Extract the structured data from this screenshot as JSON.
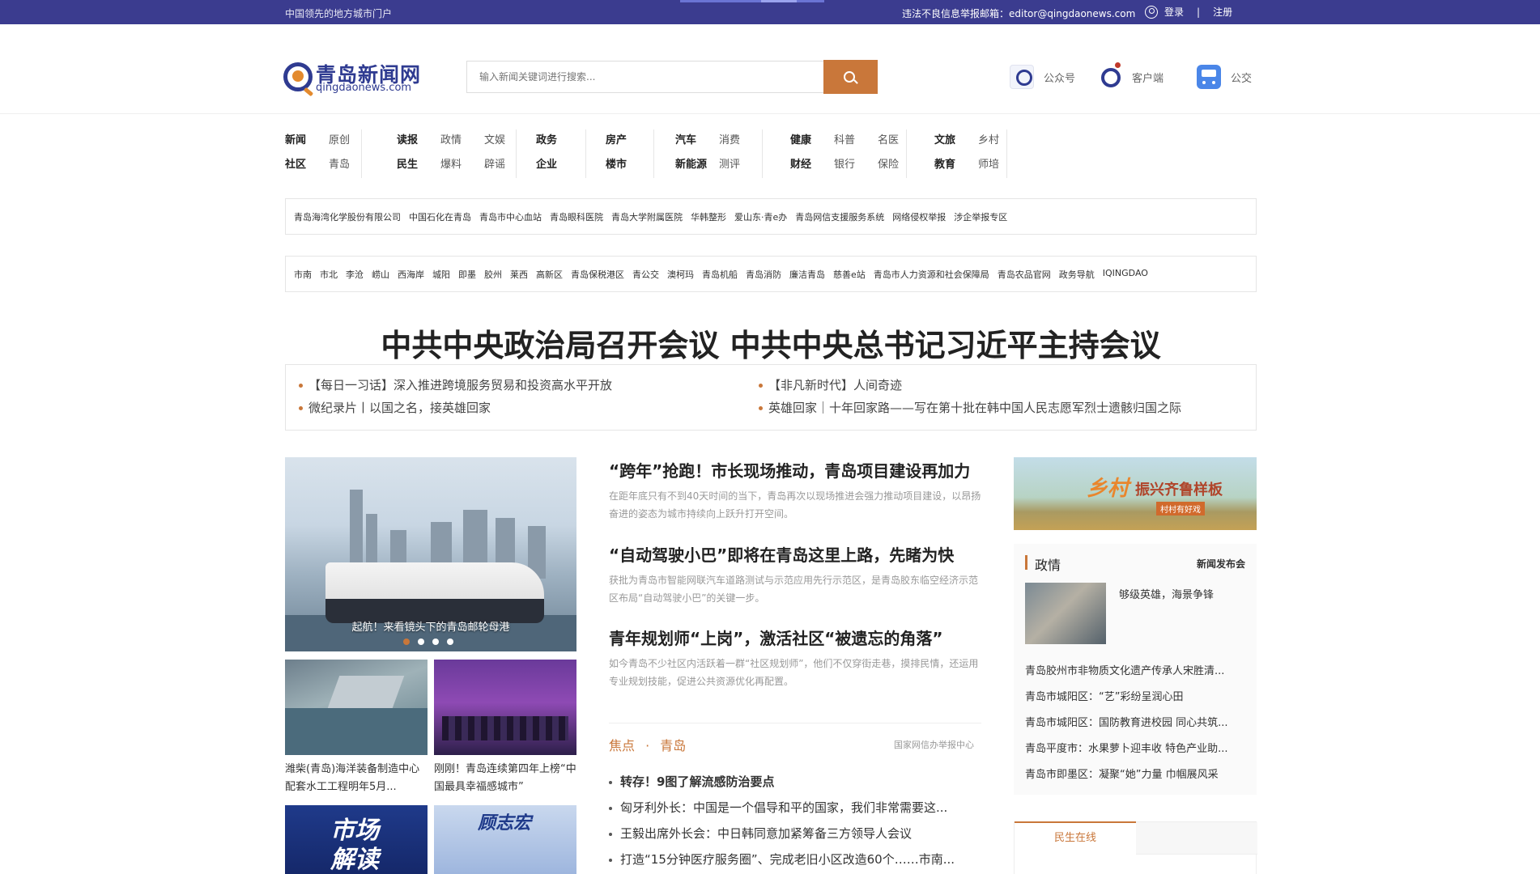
{
  "topbar": {
    "tagline": "中国领先的地方城市门户",
    "report": "违法不良信息举报邮箱：editor@qingdaonews.com",
    "login": "登录",
    "separator": "|",
    "register": "注册"
  },
  "header": {
    "logo_name": "青岛新闻网",
    "logo_domain": "qingdaonews.com",
    "search_placeholder": "输入新闻关键词进行搜索...",
    "links": [
      {
        "label": "公众号",
        "icon": "wechat-account-icon"
      },
      {
        "label": "客户端",
        "icon": "app-client-icon"
      },
      {
        "label": "公交",
        "icon": "bus-icon"
      }
    ]
  },
  "nav": {
    "groups": [
      {
        "rows": [
          [
            "新闻",
            "原创"
          ],
          [
            "社区",
            "青岛"
          ]
        ]
      },
      {
        "rows": [
          [
            "读报",
            "政情",
            "文娱"
          ],
          [
            "民生",
            "爆料",
            "辟谣"
          ]
        ]
      },
      {
        "rows": [
          [
            "政务"
          ],
          [
            "企业"
          ]
        ]
      },
      {
        "rows": [
          [
            "房产"
          ],
          [
            "楼市"
          ]
        ]
      },
      {
        "rows": [
          [
            "汽车",
            "消费"
          ],
          [
            "新能源",
            "测评"
          ]
        ]
      },
      {
        "rows": [
          [
            "健康",
            "科普",
            "名医"
          ],
          [
            "财经",
            "银行",
            "保险"
          ]
        ]
      },
      {
        "rows": [
          [
            "文旅",
            "乡村"
          ],
          [
            "教育",
            "师培"
          ]
        ]
      }
    ]
  },
  "link_rows": {
    "row1": [
      "青岛海湾化学股份有限公司",
      "中国石化在青岛",
      "青岛市中心血站",
      "青岛眼科医院",
      "青岛大学附属医院",
      "华韩整形",
      "爱山东·青e办",
      "青岛网信支援服务系统",
      "网络侵权举报",
      "涉企举报专区"
    ],
    "row2": [
      "市南",
      "市北",
      "李沧",
      "崂山",
      "西海岸",
      "城阳",
      "即墨",
      "胶州",
      "莱西",
      "高新区",
      "青岛保税港区",
      "青公交",
      "澳柯玛",
      "青岛机船",
      "青岛消防",
      "廉洁青岛",
      "慈善e站",
      "青岛市人力资源和社会保障局",
      "青岛农品官网",
      "政务导航",
      "IQINGDAO"
    ]
  },
  "headline": {
    "title": "中共中央政治局召开会议 中共中央总书记习近平主持会议",
    "subs": [
      "【每日一习话】深入推进跨境服务贸易和投资高水平开放",
      "【非凡新时代】人间奇迹",
      "微纪录片丨以国之名，接英雄回家",
      "英雄回家｜十年回家路——写在第十批在韩中国人民志愿军烈士遗骸归国之际"
    ]
  },
  "slider": {
    "caption": "起航！来看镜头下的青岛邮轮母港",
    "dots": 4,
    "active": 1
  },
  "thumbs": [
    {
      "caption": "潍柴(青岛)海洋装备制造中心配套水工工程明年5月..."
    },
    {
      "caption": "刚刚！青岛连续第四年上榜“中国最具幸福感城市”"
    },
    {
      "caption": "",
      "overlay": "市场解读"
    },
    {
      "caption": "",
      "overlay": "顾志宏"
    }
  ],
  "news": [
    {
      "title": "“跨年”抢跑！市长现场推动，青岛项目建设再加力",
      "desc": "在距年底只有不到40天时间的当下，青岛再次以现场推进会强力推动项目建设，以昂扬奋进的姿态为城市持续向上跃升打开空间。"
    },
    {
      "title": "“自动驾驶小巴”即将在青岛这里上路，先睹为快",
      "desc": "获批为青岛市智能网联汽车道路测试与示范应用先行示范区，是青岛胶东临空经济示范区布局“自动驾驶小巴”的关键一步。"
    },
    {
      "title": "青年规划师“上岗”，激活社区“被遗忘的角落”",
      "desc": "如今青岛不少社区内活跃着一群“社区规划师”，他们不仅穿街走巷，摸排民情，还运用专业规划技能，促进公共资源优化再配置。"
    }
  ],
  "focus": {
    "tab1": "焦点",
    "dot": "·",
    "tab2": "青岛",
    "right": "国家网信办举报中心",
    "items": [
      "转存！9图了解流感防治要点",
      "匈牙利外长：中国是一个倡导和平的国家，我们非常需要这...",
      "王毅出席外长会：中日韩同意加紧筹备三方领导人会议",
      "打造“15分钟医疗服务圈”、完成老旧小区改造60个……市南..."
    ]
  },
  "banner": {
    "t1": "乡村",
    "t2": "振兴齐鲁样板",
    "t3": "村村有好戏"
  },
  "policy": {
    "title": "政情",
    "more": "新闻发布会",
    "pic_title": "够级英雄，海景争锋",
    "items": [
      "青岛胶州市非物质文化遗产传承人宋胜清...",
      "青岛市城阳区：“艺”彩纷呈润心田",
      "青岛市城阳区：国防教育进校园 同心共筑...",
      "青岛平度市：水果萝卜迎丰收 特色产业助...",
      "青岛市即墨区：凝聚“她”力量 巾帼展风采"
    ]
  },
  "tabs": {
    "active": "民生在线"
  },
  "colors": {
    "topbar": "#3b3c8f",
    "accent": "#c9773a",
    "brand": "#2f3b91"
  }
}
